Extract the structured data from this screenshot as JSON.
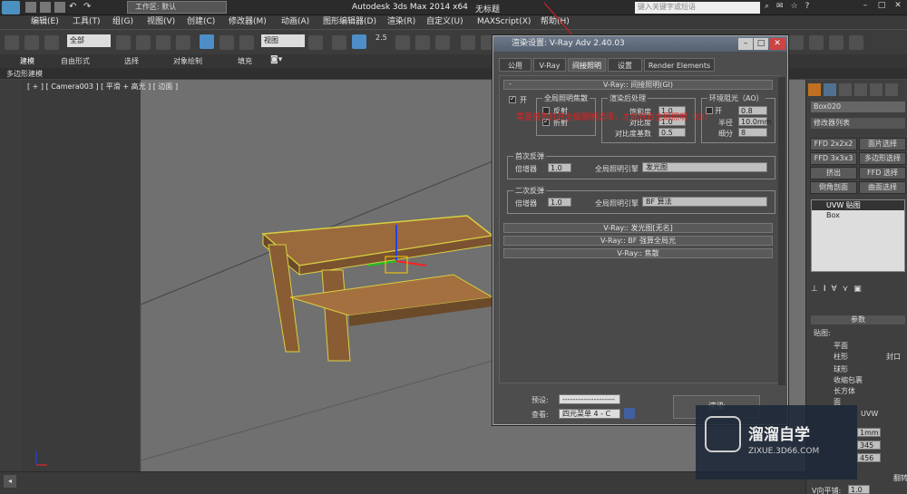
{
  "titlebar": {
    "workspace_label": "工作区: 默认",
    "app_title": "Autodesk 3ds Max  2014 x64",
    "file_title": "无标题",
    "search_placeholder": "键入关键字或短语"
  },
  "menu": [
    "编辑(E)",
    "工具(T)",
    "组(G)",
    "视图(V)",
    "创建(C)",
    "修改器(M)",
    "动画(A)",
    "图形编辑器(D)",
    "渲染(R)",
    "自定义(U)",
    "MAXScript(X)",
    "帮助(H)"
  ],
  "toolbar": {
    "selection_filter": "全部",
    "ref_coord": "视图",
    "snap_num": "2.5"
  },
  "ribbon": {
    "tabs": [
      "建模",
      "自由形式",
      "选择",
      "对象绘制",
      "填充"
    ],
    "subtab": "多边形建模"
  },
  "viewport": {
    "label": "[ + ] [ Camera003 ] [ 平滑 + 高光 ] [ 边面 ]"
  },
  "dialog": {
    "title": "渲染设置: V-Ray Adv 2.40.03",
    "tabs": [
      "公用",
      "V-Ray",
      "间接照明",
      "设置",
      "Render Elements"
    ],
    "active_tab": "间接照明",
    "gi_header": "V-Ray:: 间接照明(GI)",
    "on_label": "开",
    "group_caustics": "全局照明焦散",
    "reflective": "反射",
    "refractive": "折射",
    "group_post": "渲染后处理",
    "saturation": "饱和度",
    "saturation_val": "1.0",
    "contrast": "对比度",
    "contrast_val": "1.0",
    "contrast_base": "对比度基数",
    "contrast_base_val": "0.5",
    "group_ao": "环境阻光（AO）",
    "ao_on": "开",
    "ao_amount": "0.8",
    "radius": "半径",
    "radius_val": "10.0mm",
    "subdivs": "细分",
    "subdivs_val": "8",
    "primary": "首次反弹",
    "secondary": "二次反弹",
    "multiplier": "倍增器",
    "mult_val1": "1.0",
    "mult_val2": "1.0",
    "engine": "全局照明引擎",
    "engine1": "发光图",
    "engine2": "BF 算法",
    "rollouts": [
      "V-Ray:: 发光图[无名]",
      "V-Ray:: BF 强算全局光",
      "V-Ray:: 焦散"
    ],
    "preset_label": "预设:",
    "preset_val": "--------------------",
    "view_label": "查看:",
    "view_val": "四元菜单 4 - C",
    "render_btn": "渲染"
  },
  "annotation": "需要首先打开全局照明选项，才能开启全局照明（GI）",
  "panel": {
    "object": "Box020",
    "modlist": "修改器列表",
    "buttons": [
      "FFD 2x2x2",
      "面片选择",
      "FFD 3x3x3",
      "多边形选择",
      "挤出",
      "FFD 选择",
      "倒角剖面",
      "曲面选择"
    ],
    "stack": [
      "UVW 贴图",
      "Box"
    ],
    "params": "参数",
    "mapping": "贴图:",
    "maps": [
      "平面",
      "柱形",
      "封口",
      "球形",
      "收缩包裹",
      "长方体",
      "面"
    ],
    "uvw": "UVW",
    "vals": [
      "1mm",
      "345",
      "456"
    ],
    "flip": "翻转",
    "tile": "V向平铺:",
    "tile_val": "1.0"
  },
  "watermark": {
    "name": "溜溜自学",
    "url": "ZIXUE.3D66.COM"
  }
}
